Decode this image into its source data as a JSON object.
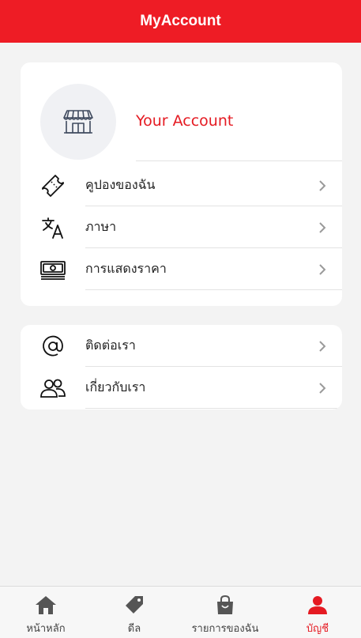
{
  "header": {
    "title": "MyAccount"
  },
  "profile": {
    "title": "Your Account"
  },
  "menu_primary": [
    {
      "label": "คูปองของฉัน",
      "icon": "ticket-icon"
    },
    {
      "label": "ภาษา",
      "icon": "translate-icon"
    },
    {
      "label": "การแสดงราคา",
      "icon": "money-icon"
    }
  ],
  "menu_secondary": [
    {
      "label": "ติดต่อเรา",
      "icon": "at-icon"
    },
    {
      "label": "เกี่ยวกับเรา",
      "icon": "people-icon"
    }
  ],
  "bottom_nav": [
    {
      "label": "หน้าหลัก",
      "icon": "home-icon",
      "active": false
    },
    {
      "label": "ดีล",
      "icon": "tag-icon",
      "active": false
    },
    {
      "label": "รายการของฉัน",
      "icon": "bag-icon",
      "active": false
    },
    {
      "label": "บัญชี",
      "icon": "person-icon",
      "active": true
    }
  ],
  "colors": {
    "primary": "#ee1c25",
    "active": "#e51a22",
    "background": "#f3f3f3"
  }
}
